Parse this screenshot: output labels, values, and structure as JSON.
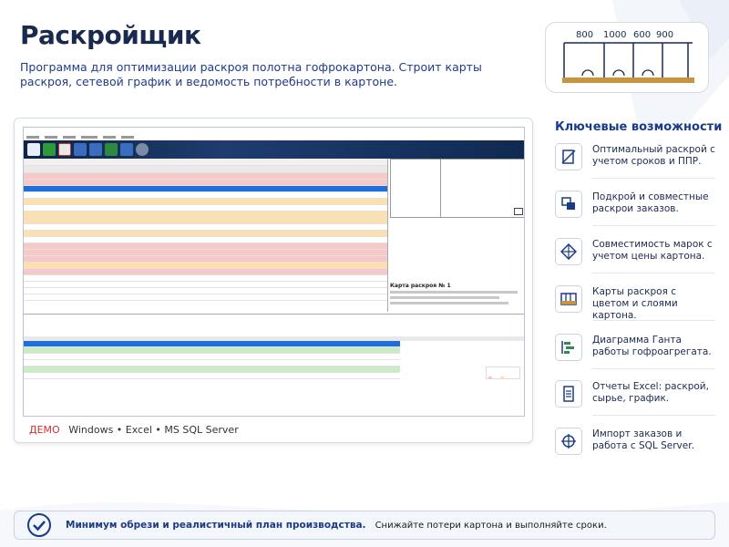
{
  "header": {
    "title": "Раскройщик",
    "subtitle": "Программа для оптимизации раскроя полотна гофрокартона. Строит карты раскроя, сетевой график и ведомость потребности в картоне."
  },
  "diagram": {
    "labels": [
      "800",
      "1000",
      "600",
      "900"
    ]
  },
  "screenshot_caption": {
    "demo": "ДЕМО",
    "platforms": "Windows • Excel • MS SQL Server"
  },
  "app_window": {
    "right_pane_title": "Карта раскроя № 1"
  },
  "features": {
    "heading": "Ключевые возможности",
    "items": [
      {
        "icon": "cut-map-icon",
        "text": "Оптимальный раскрой с учетом сроков и ППР."
      },
      {
        "icon": "orders-icon",
        "text": "Подкрой и совместные раскрои заказов."
      },
      {
        "icon": "compat-icon",
        "text": "Совместимость марок с учетом цены картона."
      },
      {
        "icon": "layers-icon",
        "text": "Карты раскроя с цветом и слоями картона."
      },
      {
        "icon": "gantt-icon",
        "text": "Диаграмма Ганта работы гофроагрегата."
      },
      {
        "icon": "excel-report-icon",
        "text": "Отчеты Excel: раскрой, сырье, график."
      },
      {
        "icon": "sql-import-icon",
        "text": "Импорт заказов и работа с SQL Server."
      }
    ]
  },
  "footer": {
    "bold": "Минимум обрези и реалистичный план производства.",
    "regular": "Снижайте потери картона и выполняйте сроки."
  },
  "colors": {
    "brand": "#1a3a8a",
    "accent": "#1e3c6e",
    "demo": "#d32f2f",
    "row_selected": "#1e6fd9",
    "row_red": "#f7c8c8",
    "row_orange": "#fde0b0",
    "row_green": "#c9ecc4"
  }
}
